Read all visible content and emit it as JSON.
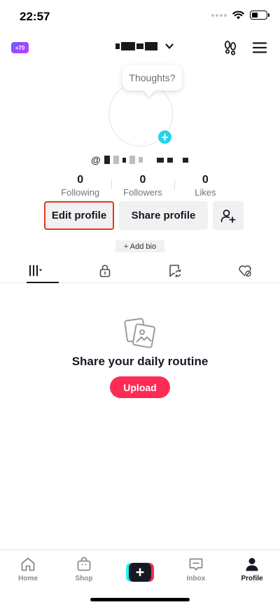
{
  "status_bar": {
    "time": "22:57",
    "battery_level": 0.35
  },
  "header": {
    "coin_badge": "+70"
  },
  "profile": {
    "thoughts_prompt": "Thoughts?",
    "stats": [
      {
        "value": "0",
        "label": "Following"
      },
      {
        "value": "0",
        "label": "Followers"
      },
      {
        "value": "0",
        "label": "Likes"
      }
    ]
  },
  "actions": {
    "edit_profile": "Edit profile",
    "share_profile": "Share profile",
    "add_bio": "+ Add bio"
  },
  "empty_state": {
    "title": "Share your daily routine",
    "button": "Upload"
  },
  "bottom_nav": {
    "home": "Home",
    "shop": "Shop",
    "create": "+",
    "inbox": "Inbox",
    "profile": "Profile"
  },
  "colors": {
    "accent": "#fe2c55",
    "highlight_border": "#e8351c",
    "avatar_plus": "#20d5ec"
  }
}
